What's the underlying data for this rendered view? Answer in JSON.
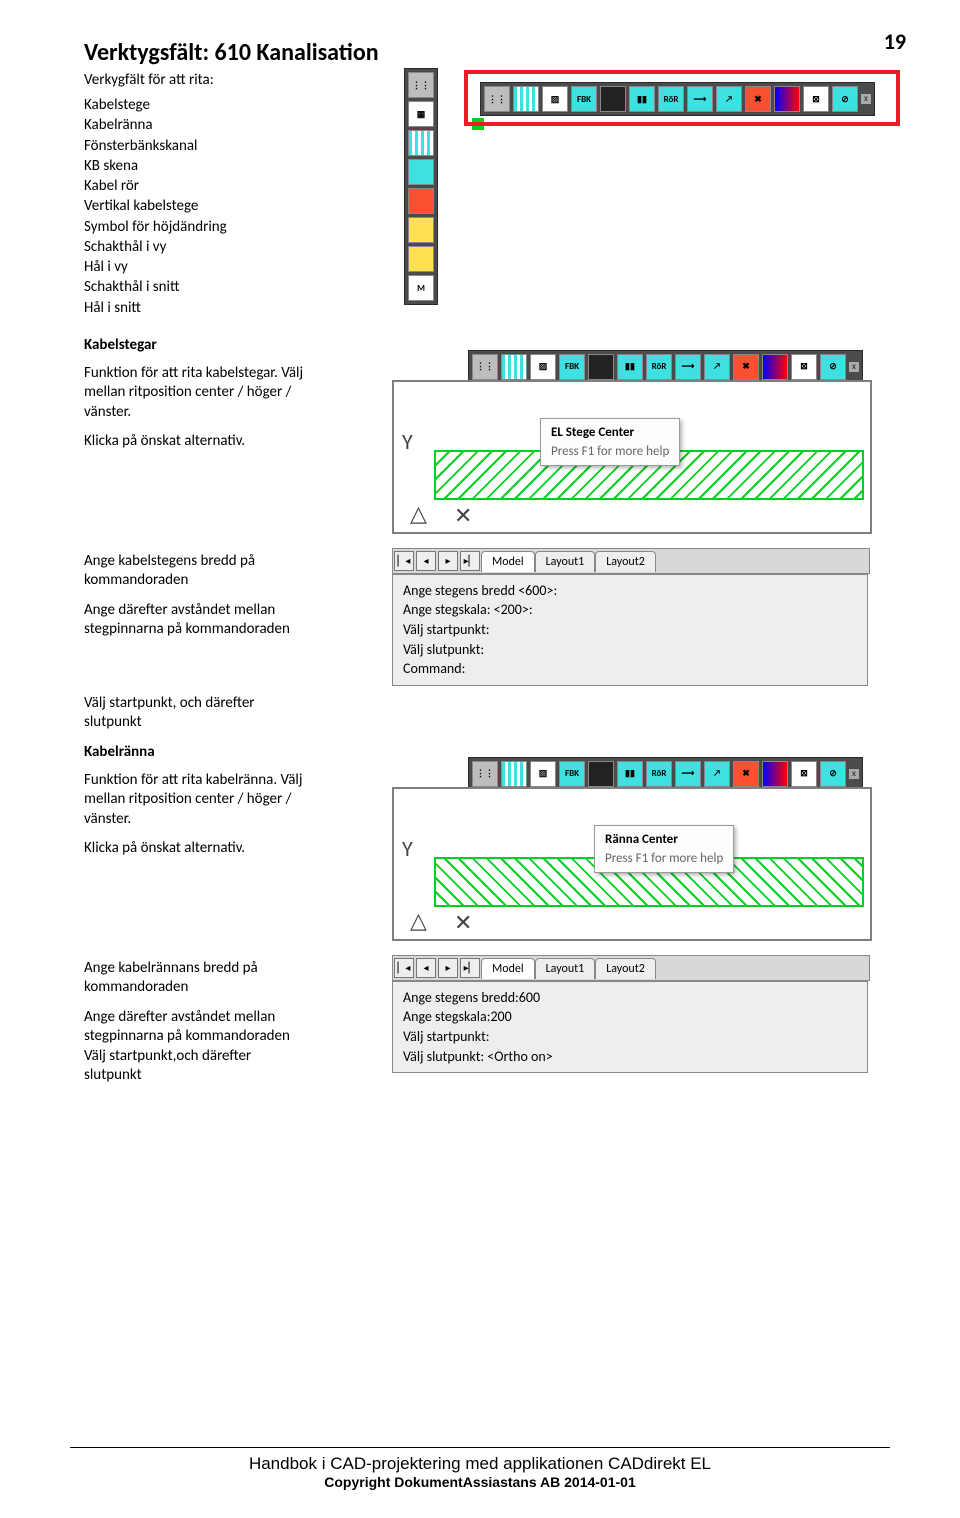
{
  "pagenum": "19",
  "heading": "Verktygsfält: 610 Kanalisation",
  "subheading": "Verkygfält för att rita:",
  "tool_list": [
    "Kabelstege",
    "Kabelränna",
    "Fönsterbänkskanal",
    "KB skena",
    "Kabel rör",
    "Vertikal kabelstege",
    "Symbol för höjdändring",
    "Schakthål i vy",
    "Hål i vy",
    "Schakthål i snitt",
    "Hål i snitt"
  ],
  "sec1_title": "Kabelstegar",
  "sec1_p1": "Funktion för att rita kabelstegar. Välj mellan ritposition center / höger / vänster.",
  "sec1_p2": "Klicka på önskat alternativ.",
  "sec1_p3": "Ange kabelstegens bredd på kommandoraden",
  "sec1_p4": "Ange därefter avståndet mellan stegpinnarna på kommandoraden",
  "sec1_p5": "Välj startpunkt, och därefter slutpunkt",
  "sec2_title": "Kabelränna",
  "sec2_p1": "Funktion för att rita kabelränna. Välj mellan ritposition center / höger / vänster.",
  "sec2_p2": "Klicka på önskat alternativ.",
  "sec2_p3": "Ange kabelrännans bredd på kommandoraden",
  "sec2_p4": "Ange därefter avståndet mellan stegpinnarna på kommandoraden Välj startpunkt,och därefter slutpunkt",
  "tooltip1_title": "EL Stege Center",
  "tooltip1_sub": "Press F1 for more help",
  "tooltip2_title": "Ränna Center",
  "tooltip2_sub": "Press F1 for more help",
  "icon_label_fbk": "FBK",
  "icon_label_ror": "RöR",
  "icon_label_m": "M",
  "tab_model": "Model",
  "tab_layout1": "Layout1",
  "tab_layout2": "Layout2",
  "cmd1": [
    "Ange stegens bredd <600>:",
    "Ange stegskala: <200>:",
    "Välj startpunkt:",
    "Välj slutpunkt:",
    "",
    "Command:"
  ],
  "cmd2": [
    "Ange stegens bredd:600",
    "Ange stegskala:200",
    "Välj startpunkt:",
    "Välj slutpunkt: <Ortho on>"
  ],
  "footer_line1": "Handbok i CAD-projektering med applikationen CADdirekt EL",
  "footer_line2": "Copyright DokumentAssiastans AB 2014-01-01"
}
